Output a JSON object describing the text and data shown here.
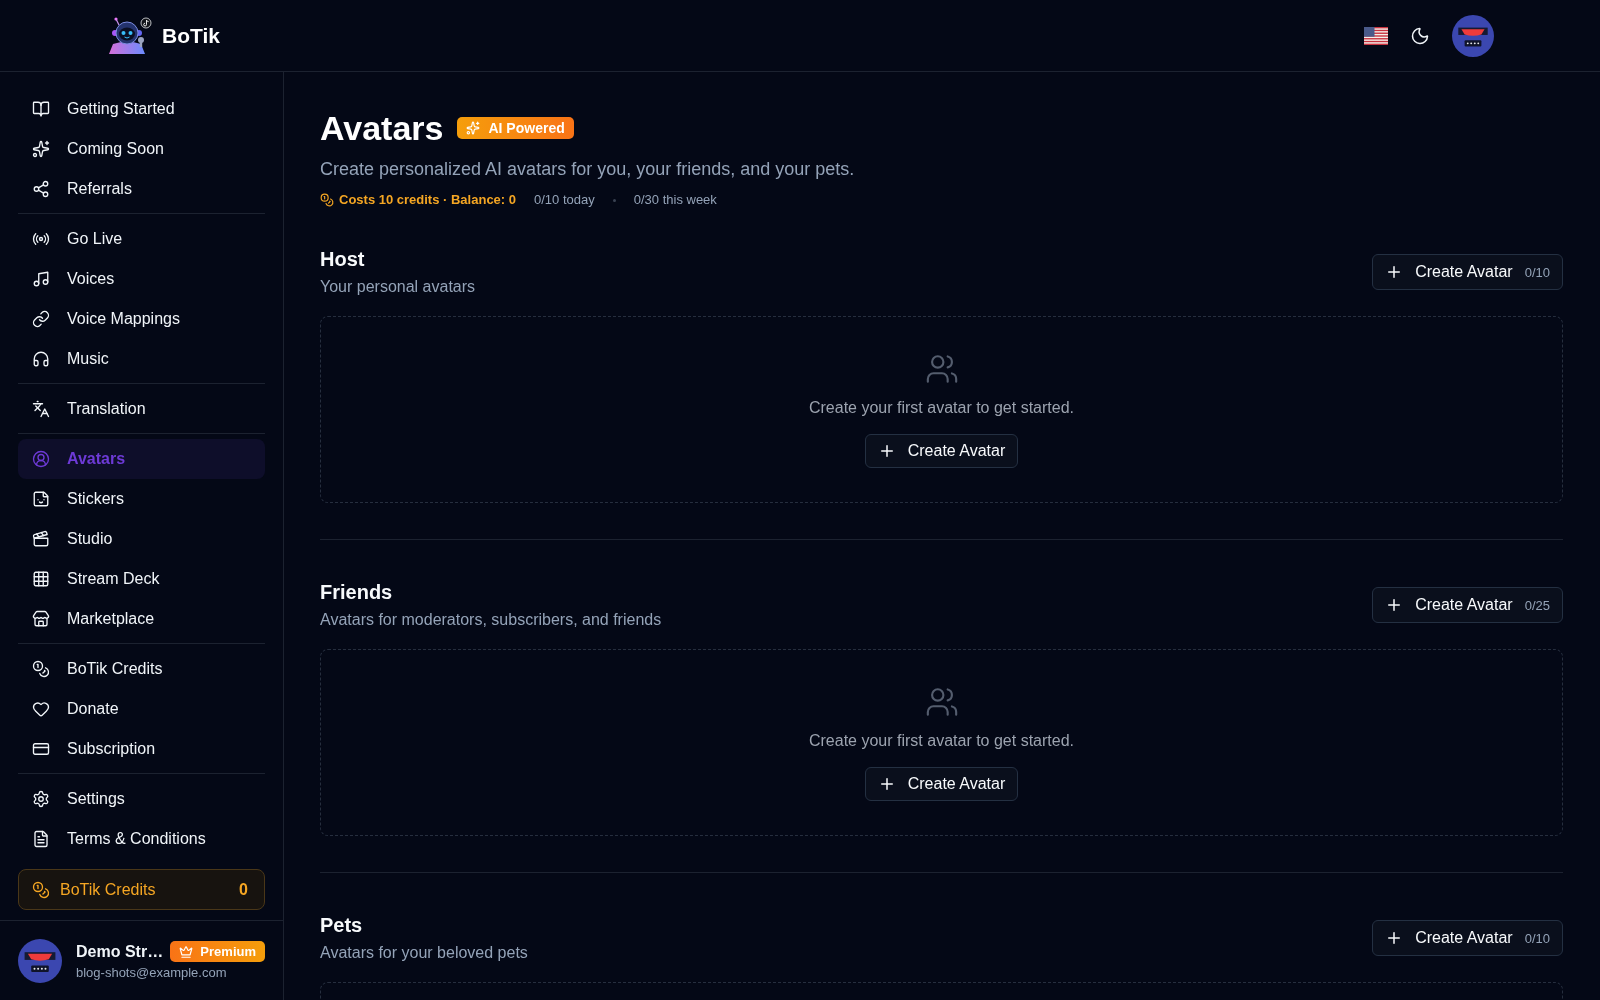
{
  "header": {
    "brand": "BoTik"
  },
  "sidebar": {
    "groups": [
      {
        "items": [
          {
            "label": "Getting Started",
            "selected": false
          },
          {
            "label": "Coming Soon",
            "selected": false
          },
          {
            "label": "Referrals",
            "selected": false
          }
        ]
      },
      {
        "items": [
          {
            "label": "Go Live",
            "selected": false
          },
          {
            "label": "Voices",
            "selected": false
          },
          {
            "label": "Voice Mappings",
            "selected": false
          },
          {
            "label": "Music",
            "selected": false
          }
        ]
      },
      {
        "items": [
          {
            "label": "Translation",
            "selected": false
          }
        ]
      },
      {
        "items": [
          {
            "label": "Avatars",
            "selected": true
          },
          {
            "label": "Stickers",
            "selected": false
          },
          {
            "label": "Studio",
            "selected": false
          },
          {
            "label": "Stream Deck",
            "selected": false
          },
          {
            "label": "Marketplace",
            "selected": false
          }
        ]
      },
      {
        "items": [
          {
            "label": "BoTik Credits",
            "selected": false
          },
          {
            "label": "Donate",
            "selected": false
          },
          {
            "label": "Subscription",
            "selected": false
          }
        ]
      },
      {
        "items": [
          {
            "label": "Settings",
            "selected": false
          },
          {
            "label": "Terms & Conditions",
            "selected": false
          }
        ]
      }
    ],
    "credits": {
      "label": "BoTik Credits",
      "value": "0"
    },
    "user": {
      "name": "Demo Str…",
      "badge": "Premium",
      "email": "blog-shots@example.com"
    }
  },
  "page": {
    "title": "Avatars",
    "badge": "AI Powered",
    "subtitle": "Create personalized AI avatars for you, your friends, and your pets.",
    "cost": "Costs 10 credits · Balance: 0",
    "usage": [
      "0/10 today",
      "0/30 this week"
    ]
  },
  "sections": [
    {
      "title": "Host",
      "subtitle": "Your personal avatars",
      "create_button": {
        "label": "Create Avatar",
        "count": "0/10"
      },
      "empty_state": {
        "text": "Create your first avatar to get started.",
        "button": "Create Avatar"
      }
    },
    {
      "title": "Friends",
      "subtitle": "Avatars for moderators, subscribers, and friends",
      "create_button": {
        "label": "Create Avatar",
        "count": "0/25"
      },
      "empty_state": {
        "text": "Create your first avatar to get started.",
        "button": "Create Avatar"
      }
    },
    {
      "title": "Pets",
      "subtitle": "Avatars for your beloved pets",
      "create_button": {
        "label": "Create Avatar",
        "count": "0/10"
      }
    }
  ]
}
